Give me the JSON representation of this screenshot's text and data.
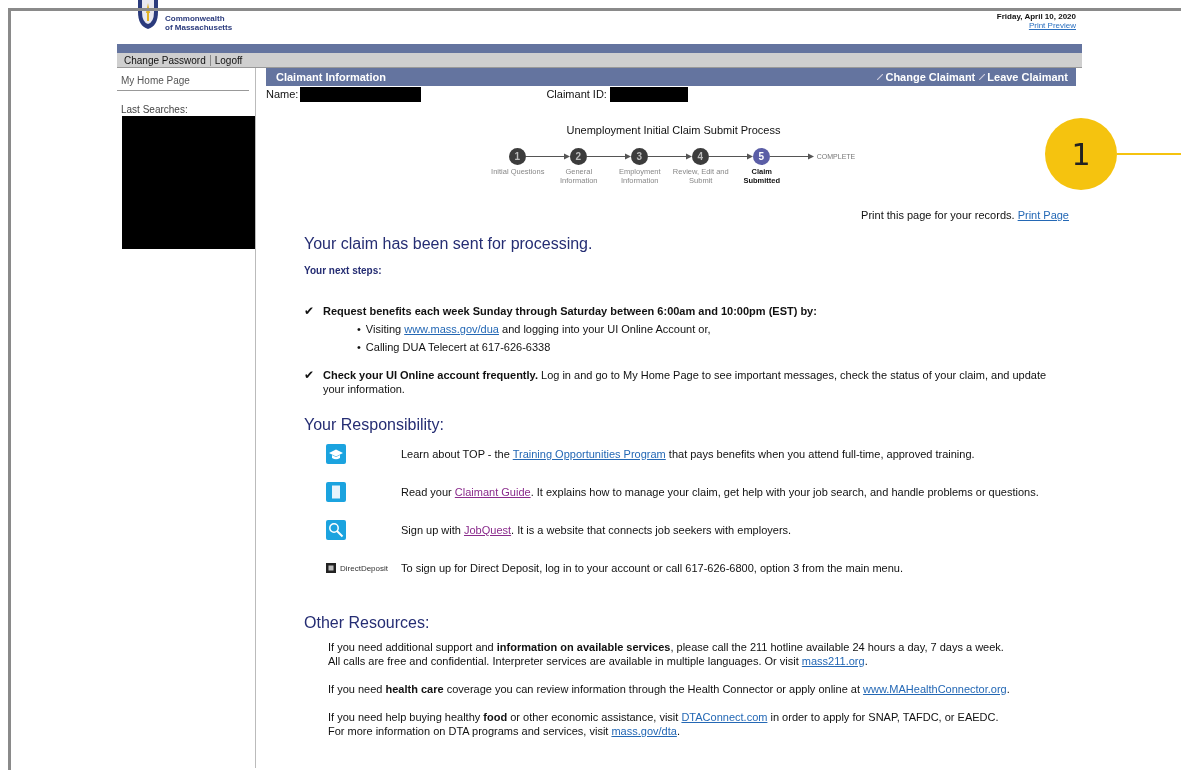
{
  "header": {
    "logo_text": [
      "Commonwealth",
      "of Massachusetts"
    ],
    "date": "Friday, April 10, 2020",
    "print_preview": "Print Preview"
  },
  "menu": [
    "Change Password",
    "Logoff"
  ],
  "sidebar": {
    "home_link": "My Home Page",
    "last_searches": "Last Searches:"
  },
  "panel": {
    "title": "Claimant Information",
    "actions": [
      "Change Claimant",
      "Leave Claimant"
    ],
    "name_label": "Name:",
    "id_label": "Claimant ID:"
  },
  "process": {
    "title": "Unemployment Initial Claim Submit Process",
    "complete": "COMPLETE",
    "steps": [
      {
        "number": "1",
        "label": "Initial Questions",
        "current": false
      },
      {
        "number": "2",
        "label": "General Information",
        "current": false
      },
      {
        "number": "3",
        "label": "Employment Information",
        "current": false
      },
      {
        "number": "4",
        "label": "Review, Edit and Submit",
        "current": false
      },
      {
        "number": "5",
        "label": "Claim Submitted",
        "current": true
      }
    ]
  },
  "print_note": {
    "text": "Print this page for your records.",
    "link": "Print Page"
  },
  "confirmation": "Your claim has been sent for processing.",
  "next_steps_label": "Your next steps:",
  "next_steps": [
    {
      "mark": "✔",
      "parts": [
        {
          "kind": "text",
          "text": "**Request benefits each week Sunday through Saturday between 6:00am and 10:00pm (EST) by:**"
        }
      ],
      "bullets": [
        {
          "bullet": "•",
          "parts": [
            {
              "kind": "text",
              "text": "Visiting "
            },
            {
              "kind": "link",
              "text": "www.mass.gov/dua"
            },
            {
              "kind": "text",
              "text": " and logging into your UI Online Account or,"
            }
          ]
        },
        {
          "bullet": "•",
          "parts": [
            {
              "kind": "text",
              "text": "Calling DUA Telecert at 617-626-6338"
            }
          ]
        }
      ]
    },
    {
      "mark": "✔",
      "parts": [
        {
          "kind": "text",
          "text": "**Check your UI Online account frequently.** Log in and go to My Home Page to see important messages, check the status of your claim, and update your information."
        }
      ]
    }
  ],
  "responsibility_title": "Your Responsibility:",
  "responsibilities": [
    {
      "kind": "training",
      "parts": [
        {
          "kind": "text",
          "text": "Learn about TOP - the "
        },
        {
          "kind": "link",
          "text": "Training Opportunities Program"
        },
        {
          "kind": "text",
          "text": " that pays benefits when you attend full-time, approved training."
        }
      ]
    },
    {
      "kind": "guide",
      "parts": [
        {
          "kind": "text",
          "text": "Read your "
        },
        {
          "kind": "visited",
          "text": "Claimant Guide"
        },
        {
          "kind": "text",
          "text": ". It explains how to manage your claim, get help with your job search, and handle problems or questions."
        }
      ]
    },
    {
      "kind": "search",
      "parts": [
        {
          "kind": "text",
          "text": "Sign up with "
        },
        {
          "kind": "visited",
          "text": "JobQuest"
        },
        {
          "kind": "text",
          "text": ". It is a website that connects job seekers with employers."
        }
      ]
    },
    {
      "kind": "deposit",
      "icon_label": "DirectDeposit",
      "parts": [
        {
          "kind": "text",
          "text": "To sign up for Direct Deposit, log in to your account or call 617-626-6800, option 3 from the main menu."
        }
      ]
    }
  ],
  "resources_title": "Other Resources:",
  "resources": [
    {
      "lines": [
        [
          {
            "kind": "text",
            "text": "If you need additional support and **information on available services**, please call the 211 hotline available 24 hours a day, 7 days a week."
          }
        ],
        [
          {
            "kind": "text",
            "text": "All calls are free and confidential. Interpreter services are available in multiple languages. Or visit "
          },
          {
            "kind": "link",
            "text": "mass211.org"
          },
          {
            "kind": "text",
            "text": "."
          }
        ]
      ]
    },
    {
      "lines": [
        [
          {
            "kind": "text",
            "text": "If you need **health care** coverage you can review information through the Health Connector or apply online at "
          },
          {
            "kind": "link",
            "text": "www.MAHealthConnector.org"
          },
          {
            "kind": "text",
            "text": "."
          }
        ]
      ]
    },
    {
      "lines": [
        [
          {
            "kind": "text",
            "text": "If you need help buying healthy **food** or other economic assistance, visit "
          },
          {
            "kind": "link",
            "text": "DTAConnect.com"
          },
          {
            "kind": "text",
            "text": " in order to apply for SNAP, TAFDC, or EAEDC."
          }
        ],
        [
          {
            "kind": "text",
            "text": "For more information on DTA programs and services, visit "
          },
          {
            "kind": "link",
            "text": "mass.gov/dta"
          },
          {
            "kind": "text",
            "text": "."
          }
        ]
      ]
    }
  ],
  "callout": {
    "number": "1"
  }
}
